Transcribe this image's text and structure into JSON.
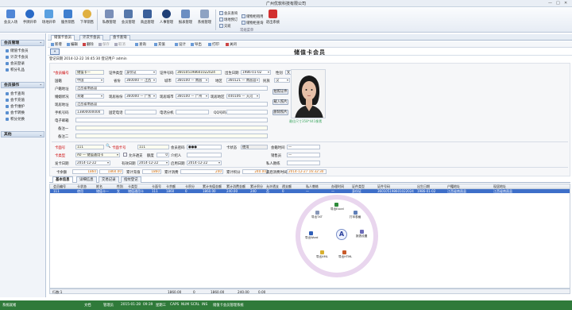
{
  "window": {
    "title": "广州优软科技有限公司",
    "controls": [
      "—",
      "□",
      "✕"
    ]
  },
  "ribbon": {
    "buttons": [
      "会员入场",
      "手牌开单",
      "场地开单",
      "服务销售",
      "下单销售",
      "私教管理",
      "会员管理",
      "商品管理",
      "人事管理",
      "报表管理",
      "系统管理",
      "退出系统"
    ],
    "small": [
      "会员查询",
      "场地预订",
      "交班",
      "储物柜租用",
      "储物柜查询"
    ],
    "group_label": "常规菜单"
  },
  "sidebar": {
    "sections": [
      {
        "title": "会员管理",
        "items": [
          "储值卡会员",
          "计次卡会员",
          "会员登录",
          "积分礼品"
        ]
      },
      {
        "title": "会员操作",
        "items": [
          "会卡查询",
          "会卡充值",
          "会卡维护",
          "会卡转换",
          "积分兑换"
        ]
      },
      {
        "title": "其他",
        "items": []
      }
    ]
  },
  "tabs": [
    "储值卡会员",
    "计次卡会员",
    "会卡查询"
  ],
  "toolbar": [
    "新增",
    "编辑",
    "删除",
    "保存",
    "取消",
    "查询",
    "充值",
    "设计",
    "导出",
    "打印",
    "关闭"
  ],
  "page": {
    "title": "储值卡会员",
    "back": "«",
    "opline": "登记日期 2014-12-22 16:45:30  登记用户 admin"
  },
  "form": {
    "member_no_label": "*会员编号",
    "member_no": "储值卡—",
    "idtype_label": "证件类型",
    "idtype": "身份证",
    "idno_label": "证件号码",
    "idno": "360105198601022024",
    "birth_label": "出生日期",
    "birth": "1986-01-02",
    "sex_label": "性别",
    "sex": "女",
    "nation_label": "国籍",
    "nation": "中国",
    "prov_label": "省份",
    "prov": "360000 — 江西",
    "city_label": "城市",
    "city": "360100 — 南昌",
    "district_label": "地区",
    "district": "360121 — 南昌县",
    "ethnic_label": "民族",
    "ethnic": "汉",
    "reg_addr_label": "户籍地址",
    "reg_addr": "江西省南昌县",
    "marital_label": "婚姻状况",
    "marital": "未婚",
    "cur_prov_label": "现居省份",
    "cur_prov": "360000 — 广东",
    "cur_city_label": "现居城市",
    "cur_city": "360100 — 广州",
    "cur_district_label": "现居地区",
    "cur_district": "440106 — 天河",
    "cur_addr_label": "现居地址",
    "cur_addr": "江西省南昌县",
    "mobile_label": "手机号码",
    "mobile": "13800000000",
    "fixed_label": "固定电话",
    "phone_label": "电话分机",
    "qq_label": "QQ号码",
    "email_label": "电子邮箱",
    "note1_label": "备注一",
    "note2_label": "备注二",
    "photo_buttons": [
      "拍照证件",
      "载入照片",
      "删除照片"
    ],
    "photo_caption": "最佳尺寸358*441像素",
    "card_no_label": "卡面号",
    "card_no": "111",
    "card_no2_label": "卡面卡号",
    "card_no2": "111",
    "pwd_label": "会员密码",
    "pwd": "●●●",
    "card_state_label": "卡状态",
    "card_state": "使用",
    "first_time_label": "会籍时间",
    "first_time": "—",
    "card_type_label": "卡类型",
    "card_type": "A0 — 储值通用卡",
    "debt_label": "允许透支",
    "debt_amount": "额度",
    "debt_value": "0",
    "referrer_label": "介绍人",
    "private_coach_label": "私人教练",
    "sales_label": "销售员",
    "sales": "—",
    "issue_label": "发卡日期",
    "issue": "2014-12-22",
    "valid_label": "有效日期",
    "valid": "2014-12-22",
    "activate_label": "启用日期",
    "activate": "2014-12-22",
    "summary": [
      {
        "label": "卡余额",
        "value": "1860"
      },
      {
        "label": "余额",
        "value": "1860.00"
      },
      {
        "label": "累计充值",
        "value": "1860"
      },
      {
        "label": "累计消费",
        "value": "240"
      },
      {
        "label": "累计积分",
        "value": "240.00"
      },
      {
        "label": "最后消费时间",
        "value": "2014-12-27 16:32:30"
      }
    ]
  },
  "bottom_tabs": [
    "基本信息",
    "详细信息",
    "交易记录",
    "指纹登记"
  ],
  "grid": {
    "headers": [
      "会员编号",
      "卡状态",
      "姓名",
      "性别",
      "卡类型",
      "卡面号",
      "卡余额",
      "卡积分",
      "累计充值金额",
      "累计消费金额",
      "累计积分",
      "允许透支",
      "透支额",
      "私人教练",
      "办理时间",
      "证件类型",
      "证件号码",
      "出生日期",
      "户籍地址",
      "现居地址"
    ],
    "row": [
      "111",
      "使用",
      "储值卡—",
      "女",
      "储值通用卡",
      "111",
      "1860",
      "0",
      "1860.00",
      "240.00",
      "240",
      "否",
      "0",
      "—",
      "—",
      "身份证",
      "360105198601022024",
      "1986-01-02",
      "江西省南昌县",
      "江西省南昌县"
    ],
    "footer": [
      "行数:1",
      "1860.00",
      "0",
      "1860.00",
      "240.00",
      "0.00"
    ]
  },
  "radial": {
    "items": [
      "导出Excel",
      "导出TXT",
      "打印表格",
      "导出Word",
      "导出HTML",
      "报表设置",
      "导出XML"
    ]
  },
  "status": [
    "系统就绪",
    "文档",
    "管理员",
    "2015-01-28",
    "09:39",
    "星期三",
    "CAPS",
    "NUM",
    "SCRL",
    "INS",
    "储值卡会员管理系统"
  ]
}
